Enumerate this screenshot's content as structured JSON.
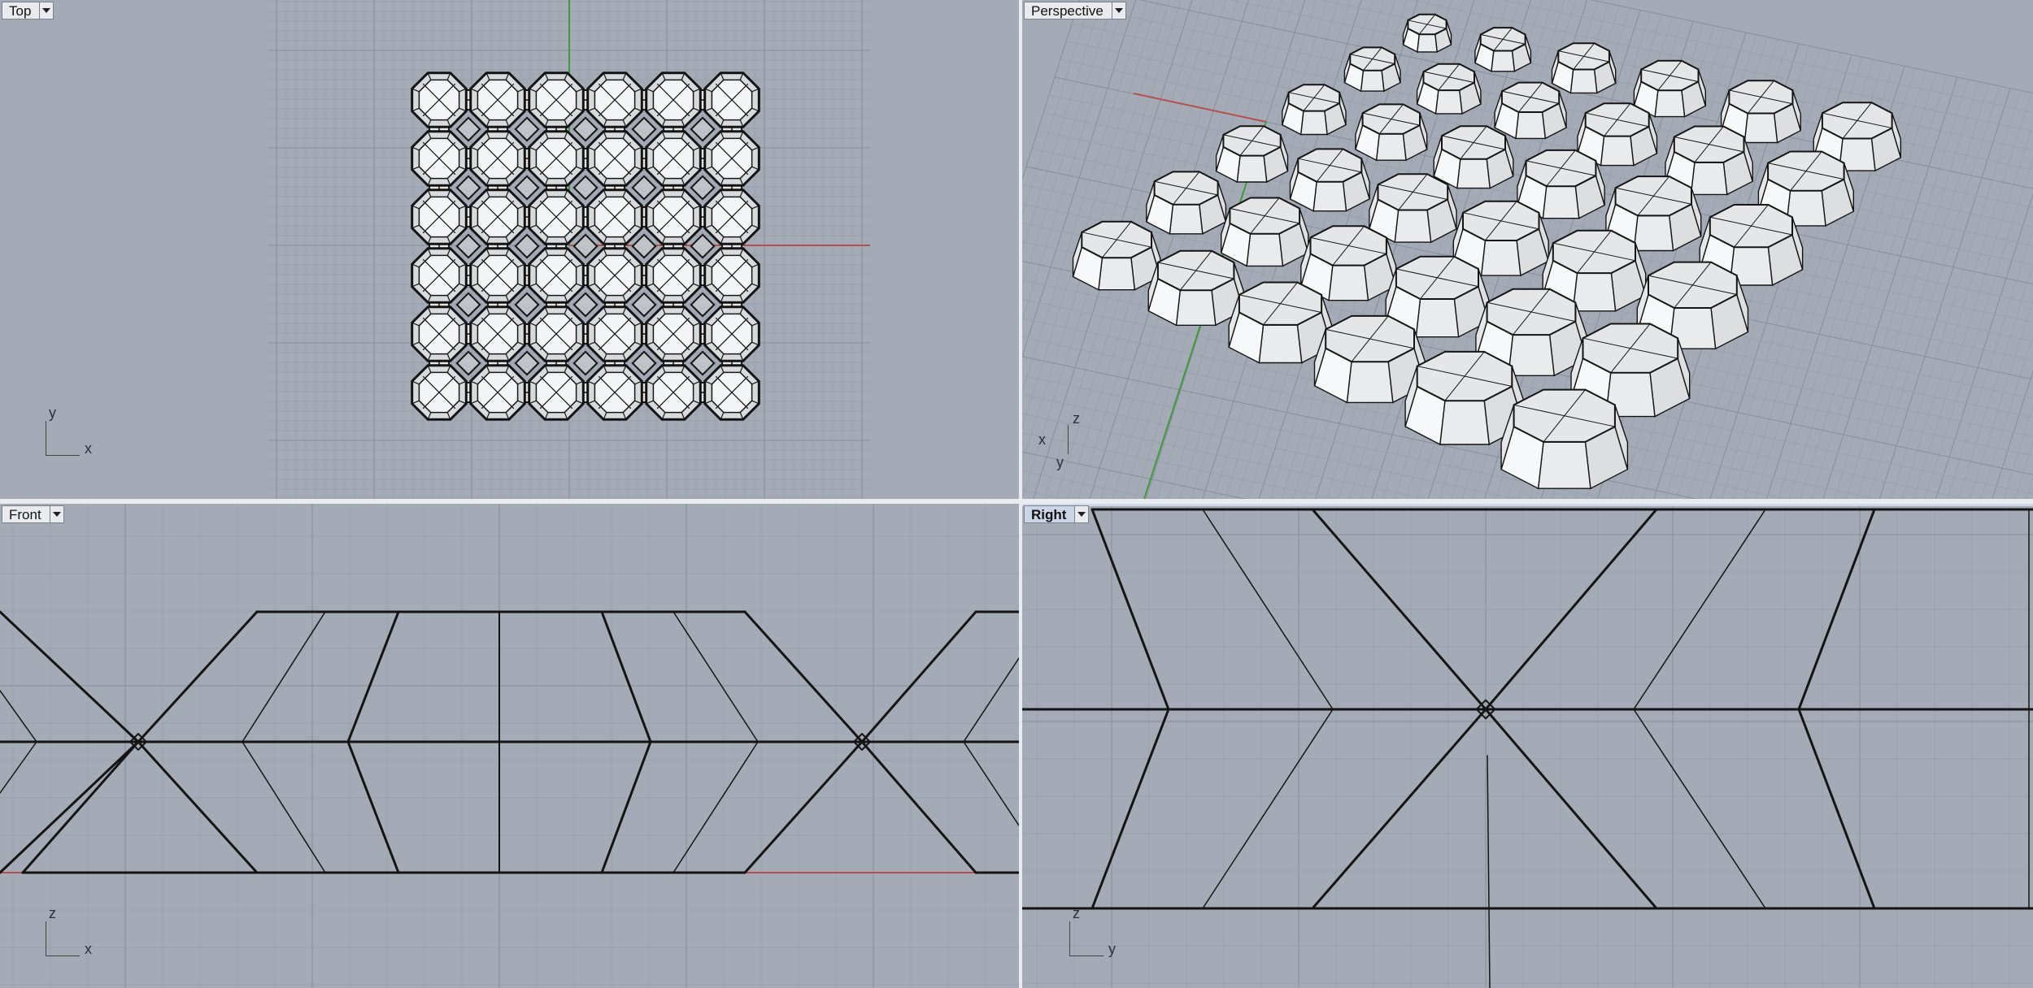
{
  "viewports": {
    "top": {
      "label": "Top",
      "axis_h": "x",
      "axis_v": "y"
    },
    "perspective": {
      "label": "Perspective",
      "axis_x": "x",
      "axis_y": "y",
      "axis_z": "z"
    },
    "front": {
      "label": "Front",
      "axis_h": "x",
      "axis_v": "z"
    },
    "right": {
      "label": "Right",
      "axis_h": "y",
      "axis_v": "z"
    }
  },
  "active_viewport": "Right",
  "colors": {
    "viewport_bg": "#a4abb6",
    "grid_minor": "#98a0ac",
    "grid_major": "#868e9a",
    "x_axis": "#b5504f",
    "y_axis": "#3f9a3c",
    "geometry": "#141414",
    "shaded_face": "#e4e6e8"
  },
  "icons": {
    "viewport_menu": "chevron-down-icon"
  }
}
